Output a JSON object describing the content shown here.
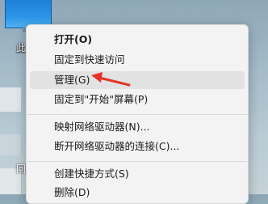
{
  "desktop": {
    "icon_label": "此",
    "side_glyph_1": "回"
  },
  "context_menu": {
    "items": [
      {
        "label": "打开(O)"
      },
      {
        "label": "固定到快速访问"
      },
      {
        "label": "管理(G)"
      },
      {
        "label": "固定到\"开始\"屏幕(P)"
      },
      {
        "label": "映射网络驱动器(N)..."
      },
      {
        "label": "断开网络驱动器的连接(C)..."
      },
      {
        "label": "创建快捷方式(S)"
      },
      {
        "label": "删除(D)"
      }
    ]
  },
  "annotation": {
    "arrow_color": "#e5332a",
    "target_item": "管理(G)"
  }
}
